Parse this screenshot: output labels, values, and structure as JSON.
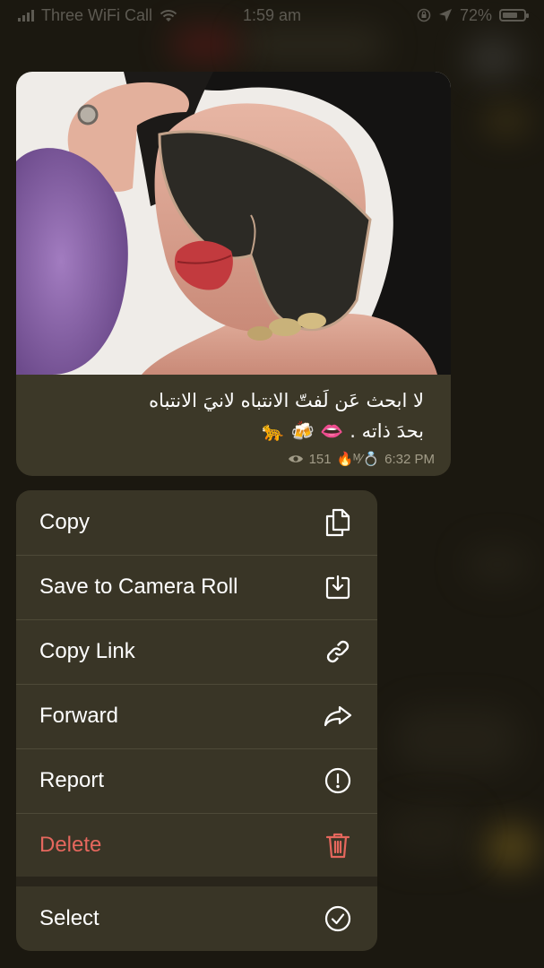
{
  "status_bar": {
    "carrier": "Three WiFi Call",
    "time": "1:59 am",
    "battery": "72%",
    "battery_level": 0.72
  },
  "message": {
    "caption_line1": "لا ابحث عَن لَفتّ  الانتباه لانيَ الانتباه",
    "caption_line2": "بحدَ ذاته . 👄 🍻 🐆",
    "views": "151",
    "signature": "🔥ᴹ⁄💍",
    "time": "6:32 PM"
  },
  "menu": {
    "items": [
      {
        "label": "Copy",
        "icon": "copy-icon"
      },
      {
        "label": "Save to Camera Roll",
        "icon": "download-icon"
      },
      {
        "label": "Copy Link",
        "icon": "link-icon"
      },
      {
        "label": "Forward",
        "icon": "forward-icon"
      },
      {
        "label": "Report",
        "icon": "report-icon"
      },
      {
        "label": "Delete",
        "icon": "trash-icon"
      },
      {
        "label": "Select",
        "icon": "check-circle-icon"
      }
    ]
  },
  "colors": {
    "background": "#1b1810",
    "bubble": "#3c3828",
    "menu": "#393526",
    "destructive": "#e5675d",
    "meta_text": "#a29c88"
  }
}
